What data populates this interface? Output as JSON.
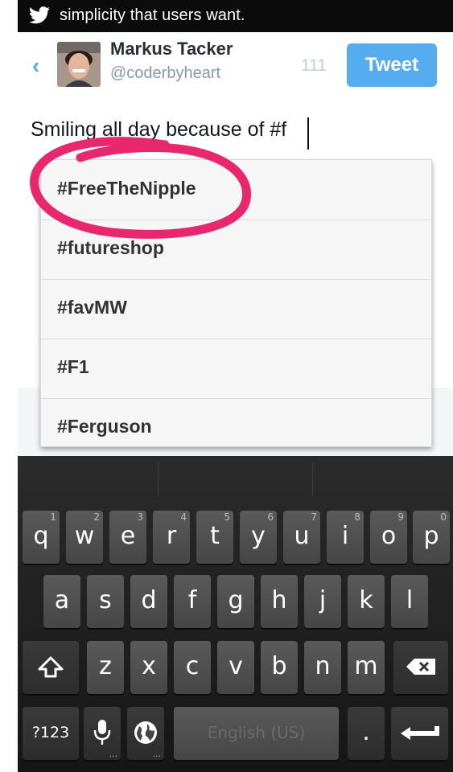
{
  "banner": {
    "text": "simplicity that users want.",
    "icon": "twitter-bird-icon"
  },
  "header": {
    "back_glyph": "‹",
    "user_name": "Markus Tacker",
    "user_handle": "@coderbyheart",
    "char_count": "111",
    "tweet_label": "Tweet"
  },
  "compose": {
    "text": "Smiling all day because of #f"
  },
  "suggestions": [
    "#FreeTheNipple",
    "#futureshop",
    "#favMW",
    "#F1",
    "#Ferguson"
  ],
  "highlight": {
    "circled_item": "#FreeTheNipple",
    "color": "#e8286e"
  },
  "keyboard": {
    "row1": [
      {
        "key": "q",
        "hint": "1"
      },
      {
        "key": "w",
        "hint": "2"
      },
      {
        "key": "e",
        "hint": "3"
      },
      {
        "key": "r",
        "hint": "4"
      },
      {
        "key": "t",
        "hint": "5"
      },
      {
        "key": "y",
        "hint": "6"
      },
      {
        "key": "u",
        "hint": "7"
      },
      {
        "key": "i",
        "hint": "8"
      },
      {
        "key": "o",
        "hint": "9"
      },
      {
        "key": "p",
        "hint": "0"
      }
    ],
    "row2": [
      "a",
      "s",
      "d",
      "f",
      "g",
      "h",
      "j",
      "k",
      "l"
    ],
    "row3": [
      "z",
      "x",
      "c",
      "v",
      "b",
      "n",
      "m"
    ],
    "symbols_label": "?123",
    "space_label": "English (US)",
    "period": ".",
    "icons": [
      "shift-icon",
      "backspace-icon",
      "mic-icon",
      "globe-icon",
      "enter-icon"
    ]
  },
  "colors": {
    "accent": "#55acee",
    "banner_bg": "#0b0b0b",
    "keyboard_bg": "#1e1e1e"
  }
}
